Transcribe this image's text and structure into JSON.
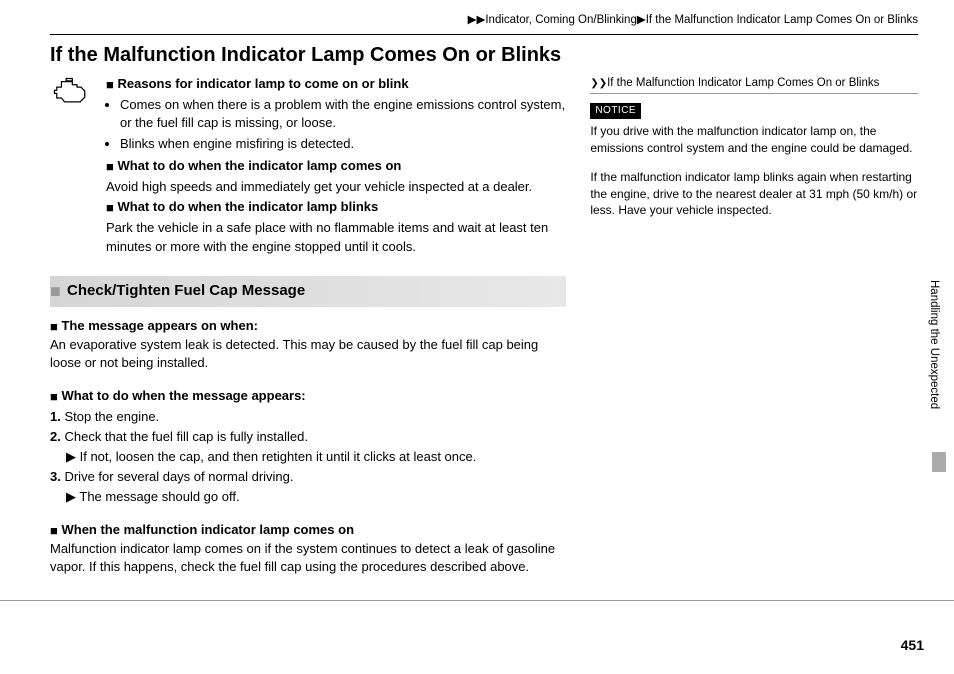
{
  "breadcrumb": "▶▶Indicator, Coming On/Blinking▶If the Malfunction Indicator Lamp Comes On or Blinks",
  "title": "If the Malfunction Indicator Lamp Comes On or Blinks",
  "section1": {
    "h1": "Reasons for indicator lamp to come on or blink",
    "b1": "Comes on when there is a problem with the engine emissions control system, or the fuel fill cap is missing, or loose.",
    "b2": "Blinks when engine misfiring is detected.",
    "h2": "What to do when the indicator lamp comes on",
    "p2": "Avoid high speeds and immediately get your vehicle inspected at a dealer.",
    "h3": "What to do when the indicator lamp blinks",
    "p3": "Park the vehicle in a safe place with no flammable items and wait at least ten minutes or more with the engine stopped until it cools."
  },
  "subhead": "Check/Tighten Fuel Cap Message",
  "section2": {
    "h1": "The message appears on when:",
    "p1": "An evaporative system leak is detected. This may be caused by the fuel fill cap being loose or not being installed.",
    "h2": "What to do when the message appears:",
    "step1": "Stop the engine.",
    "step2": "Check that the fuel fill cap is fully installed.",
    "step2a": "If not, loosen the cap, and then retighten it until it clicks at least once.",
    "step3": "Drive for several days of normal driving.",
    "step3a": "The message should go off.",
    "h3": "When the malfunction indicator lamp comes on",
    "p3": "Malfunction indicator lamp comes on if the system continues to detect a leak of gasoline vapor. If this happens, check the fuel fill cap using the procedures described above."
  },
  "sidebar": {
    "ref": "If the Malfunction Indicator Lamp Comes On or Blinks",
    "notice": "NOTICE",
    "p1": "If you drive with the malfunction indicator lamp on, the emissions control system and the engine could be damaged.",
    "p2": "If the malfunction indicator lamp blinks again when restarting the engine, drive to the nearest dealer at 31 mph (50 km/h) or less. Have your vehicle inspected."
  },
  "tab": "Handling the Unexpected",
  "pagenum": "451"
}
